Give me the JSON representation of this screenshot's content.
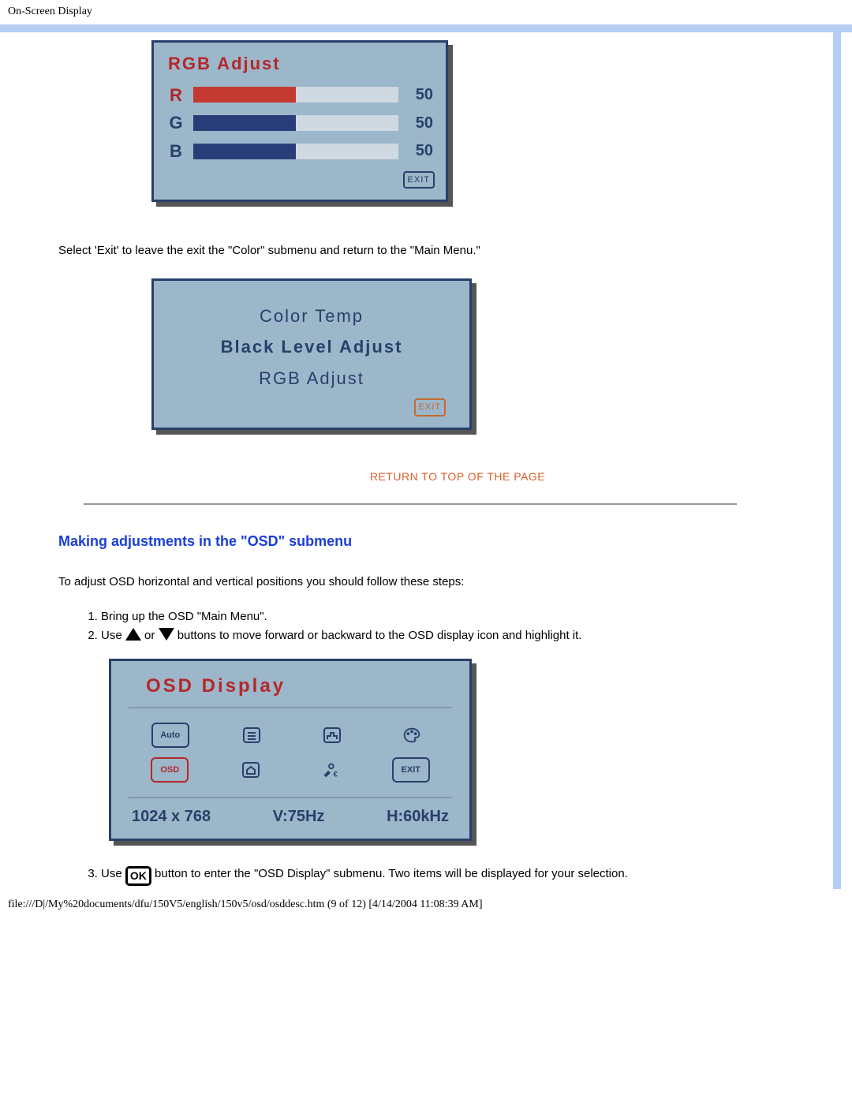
{
  "header": "On-Screen Display",
  "rgb_adjust": {
    "title": "RGB Adjust",
    "rows": [
      {
        "label": "R",
        "value": "50",
        "percent": 50,
        "color": "red"
      },
      {
        "label": "G",
        "value": "50",
        "percent": 50,
        "color": "blue"
      },
      {
        "label": "B",
        "value": "50",
        "percent": 50,
        "color": "blue"
      }
    ],
    "exit": "EXIT"
  },
  "text_after_rgb": "Select 'Exit' to leave the exit the \"Color\" submenu and return to the \"Main Menu.\"",
  "color_menu": {
    "items": [
      "Color Temp",
      "Black Level Adjust",
      "RGB Adjust"
    ],
    "exit": "EXIT"
  },
  "return_link": "RETURN TO TOP OF THE PAGE",
  "section_heading": "Making adjustments in the \"OSD\" submenu",
  "intro": "To adjust OSD horizontal and vertical positions you should follow these steps:",
  "steps": {
    "s1": "Bring up the OSD \"Main Menu\".",
    "s2a": "Use ",
    "s2_or": " or ",
    "s2b": " buttons to move forward or backward to the OSD display icon and highlight it.",
    "s3a": "Use ",
    "s3b": " button to enter the \"OSD Display\" submenu. Two items will be displayed for your selection."
  },
  "ok_label": "OK",
  "osd_display": {
    "title": "OSD Display",
    "icons_row1": [
      "Auto",
      "list",
      "bars",
      "palette"
    ],
    "icons_row2": [
      "OSD",
      "home",
      "tools",
      "EXIT"
    ],
    "status": {
      "res": "1024 x 768",
      "v": "V:75Hz",
      "h": "H:60kHz"
    }
  },
  "footer": "file:///D|/My%20documents/dfu/150V5/english/150v5/osd/osddesc.htm (9 of 12) [4/14/2004 11:08:39 AM]"
}
